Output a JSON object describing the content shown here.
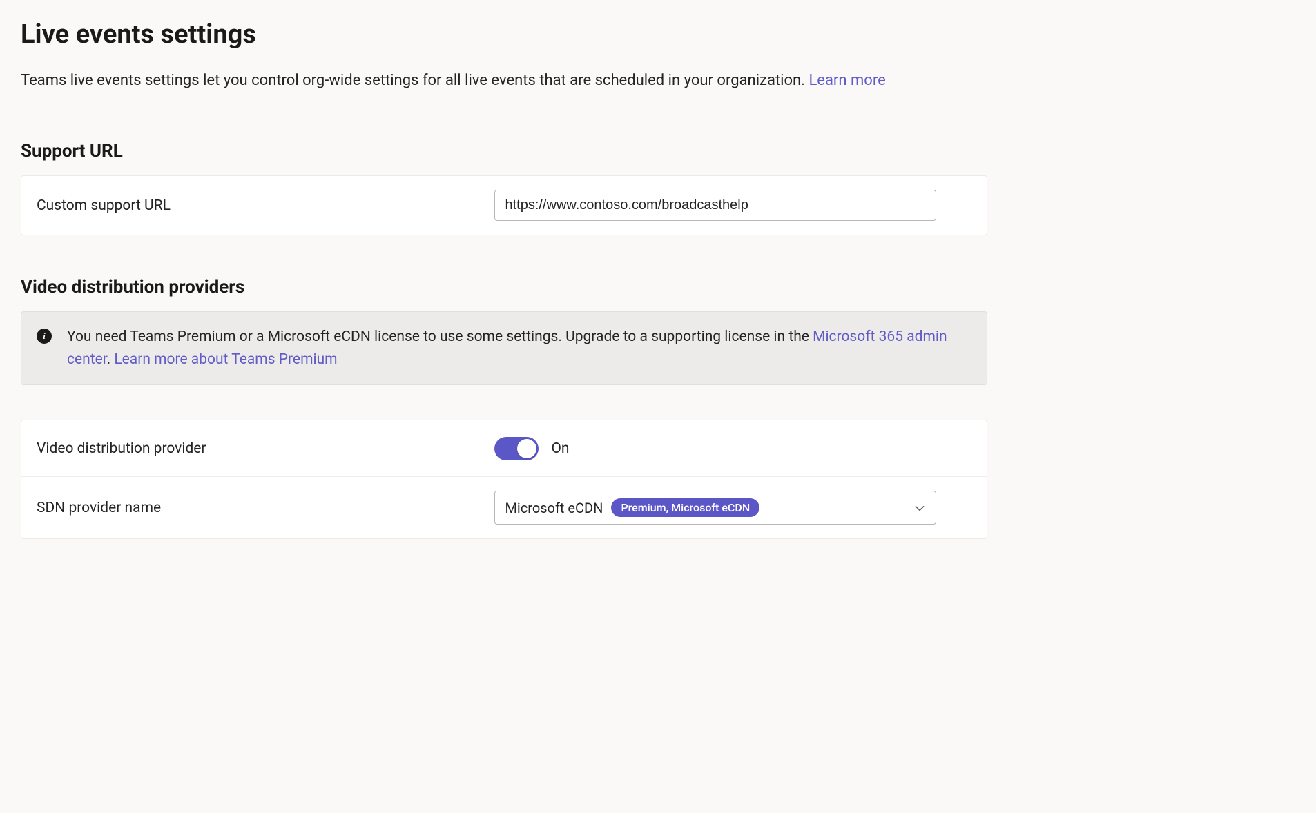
{
  "header": {
    "title": "Live events settings",
    "description_pre": "Teams live events settings let you control org-wide settings for all live events that are scheduled in your organization. ",
    "learn_more": "Learn more"
  },
  "support_url": {
    "section_title": "Support URL",
    "row_label": "Custom support URL",
    "value": "https://www.contoso.com/broadcasthelp"
  },
  "video_providers": {
    "section_title": "Video distribution providers",
    "banner": {
      "text_pre": "You need Teams Premium or a Microsoft eCDN license to use some settings. Upgrade to a supporting license in the ",
      "link_admin_center": "Microsoft 365 admin center",
      "text_mid": ". ",
      "link_learn_more": "Learn more about Teams Premium"
    },
    "toggle_row": {
      "label": "Video distribution provider",
      "state_label": "On"
    },
    "sdn_row": {
      "label": "SDN provider name",
      "selected": "Microsoft eCDN",
      "badge": "Premium, Microsoft eCDN"
    }
  }
}
